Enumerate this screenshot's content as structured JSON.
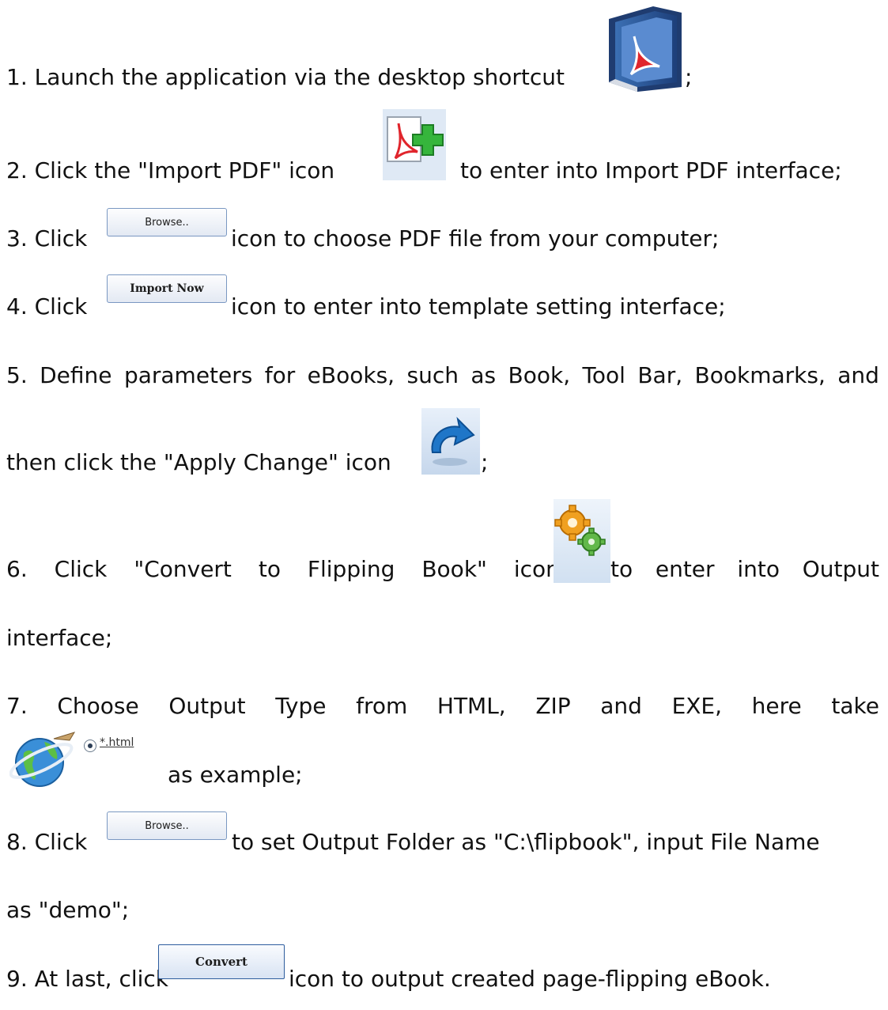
{
  "steps": {
    "s1": {
      "text": "1. Launch the application via the desktop shortcut",
      "after": ";"
    },
    "s2": {
      "before": "2. Click the \"Import PDF\" icon",
      "after": "to enter into Import PDF interface;"
    },
    "s3": {
      "before": "3. Click",
      "after": "icon to choose PDF file from your computer;"
    },
    "s4": {
      "before": "4. Click",
      "after": "icon to enter into template setting interface;"
    },
    "s5": {
      "line1_words": [
        "5.",
        "Define",
        "parameters",
        "for",
        "eBooks,",
        "such",
        "as",
        "Book,",
        "Tool",
        "Bar,",
        "Bookmarks,",
        "and"
      ],
      "line2": "then click the \"Apply Change\" icon",
      "after": ";"
    },
    "s6": {
      "line1_left": [
        "6.",
        "Click",
        "\"Convert",
        "to",
        "Flipping",
        "Book\"",
        "icon"
      ],
      "line1_right": [
        "to",
        "enter",
        "into",
        "Output"
      ],
      "line2": "interface;"
    },
    "s7": {
      "line1_words": [
        "7.",
        "Choose",
        "Output",
        "Type",
        "from",
        "HTML,",
        "ZIP",
        "and",
        "EXE,",
        "here",
        "take"
      ],
      "radio_label": "*.html",
      "line2": "as example;"
    },
    "s8": {
      "before": "8. Click",
      "after": "to set Output Folder as \"C:\\flipbook\", input File Name",
      "line2": "as \"demo\";"
    },
    "s9": {
      "before": "9. At last, click",
      "after": "icon to output created page-flipping eBook."
    }
  },
  "buttons": {
    "browse": "Browse..",
    "import_now": "Import Now",
    "convert": "Convert"
  },
  "icons": {
    "desktop_shortcut": "pdf-book-icon",
    "import_pdf": "import-pdf-plus-icon",
    "apply_change": "apply-change-arrow-icon",
    "convert_flipping": "gears-icon",
    "html_output": "globe-icon"
  }
}
